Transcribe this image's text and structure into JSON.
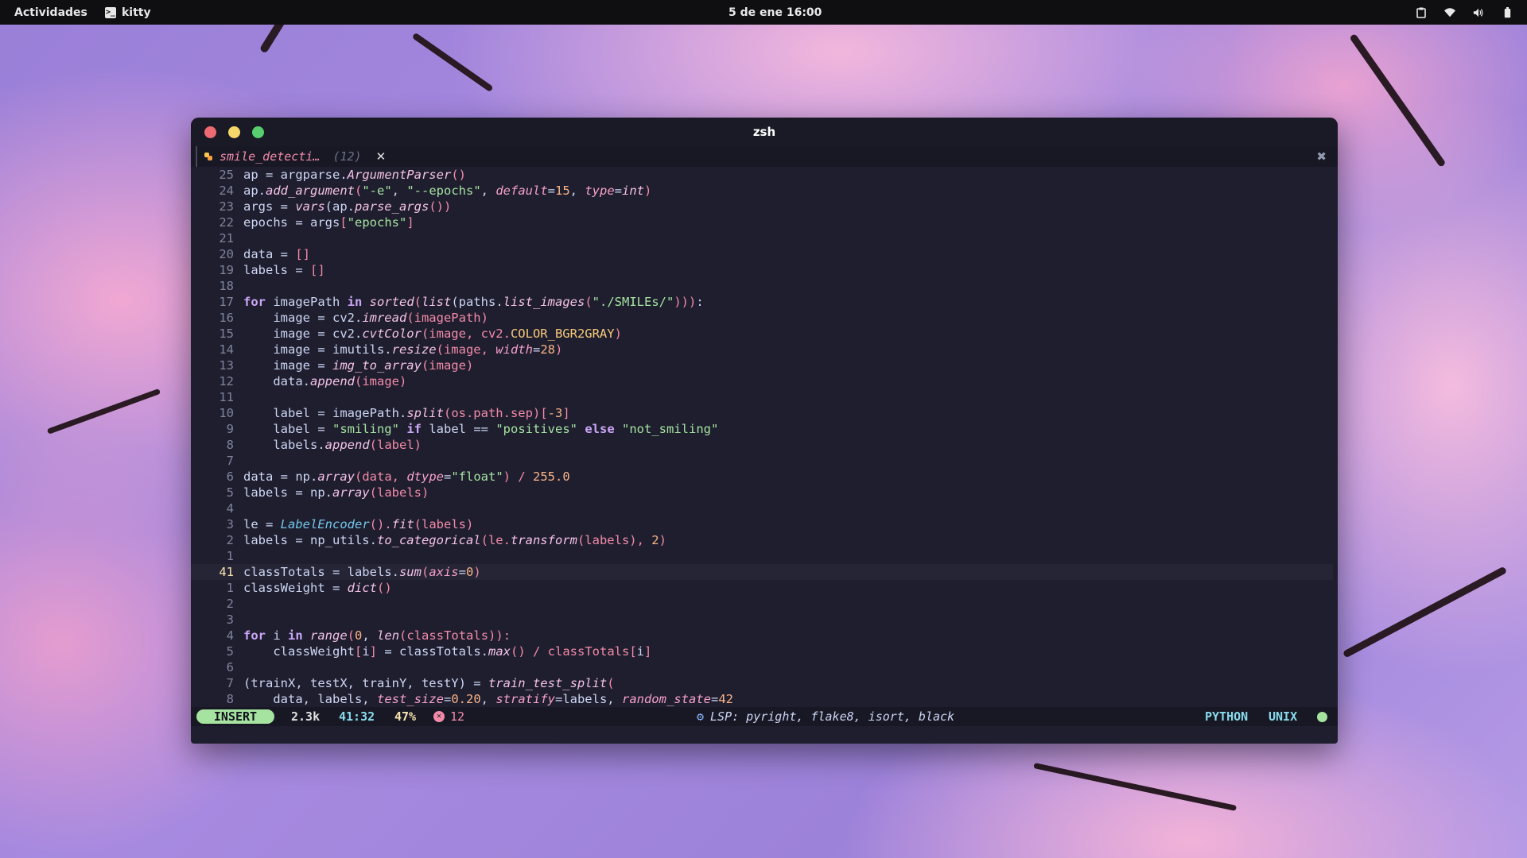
{
  "topbar": {
    "activities": "Actividades",
    "app_name": "kitty",
    "clock": "5 de ene  16:00",
    "icons": [
      "clipboard-icon",
      "wifi-icon",
      "volume-icon",
      "battery-icon"
    ]
  },
  "window": {
    "title": "zsh",
    "buffer_tab": {
      "icon": "python-icon",
      "name": "smile_detecti…",
      "count": "(12)",
      "close": "✕"
    },
    "buffer_close": "✖"
  },
  "editor": {
    "current_line_number": "41",
    "lines": [
      {
        "n": "25",
        "segs": [
          [
            "ap = argparse.",
            "o"
          ],
          [
            "ArgumentParser",
            "f"
          ],
          [
            "()",
            "p"
          ]
        ]
      },
      {
        "n": "24",
        "segs": [
          [
            "ap.",
            "o"
          ],
          [
            "add_argument",
            "f"
          ],
          [
            "(",
            "p"
          ],
          [
            "\"-e\"",
            "s"
          ],
          [
            ", ",
            "o"
          ],
          [
            "\"--epochs\"",
            "s"
          ],
          [
            ", ",
            "o"
          ],
          [
            "default",
            "a"
          ],
          [
            "=",
            "o"
          ],
          [
            "15",
            "n"
          ],
          [
            ", ",
            "o"
          ],
          [
            "type",
            "a"
          ],
          [
            "=",
            "o"
          ],
          [
            "int",
            "f"
          ],
          [
            ")",
            "p"
          ]
        ]
      },
      {
        "n": "23",
        "segs": [
          [
            "args = ",
            "o"
          ],
          [
            "vars",
            "f"
          ],
          [
            "(ap.",
            "o"
          ],
          [
            "parse_args",
            "f"
          ],
          [
            "())",
            "p"
          ]
        ]
      },
      {
        "n": "22",
        "segs": [
          [
            "epochs = args",
            "o"
          ],
          [
            "[",
            "p"
          ],
          [
            "\"epochs\"",
            "s"
          ],
          [
            "]",
            "p"
          ]
        ]
      },
      {
        "n": "21",
        "segs": []
      },
      {
        "n": "20",
        "segs": [
          [
            "data = ",
            "o"
          ],
          [
            "[]",
            "p"
          ]
        ]
      },
      {
        "n": "19",
        "segs": [
          [
            "labels = ",
            "o"
          ],
          [
            "[]",
            "p"
          ]
        ]
      },
      {
        "n": "18",
        "segs": []
      },
      {
        "n": "17",
        "segs": [
          [
            "for",
            "k"
          ],
          [
            " imagePath ",
            "o"
          ],
          [
            "in",
            "k"
          ],
          [
            " ",
            "o"
          ],
          [
            "sorted",
            "f"
          ],
          [
            "(",
            "p"
          ],
          [
            "list",
            "f"
          ],
          [
            "(paths.",
            "o"
          ],
          [
            "list_images",
            "f"
          ],
          [
            "(",
            "p"
          ],
          [
            "\"./SMILEs/\"",
            "s"
          ],
          [
            ")))",
            "p"
          ],
          [
            ":",
            "o"
          ]
        ]
      },
      {
        "n": "16",
        "segs": [
          [
            "    image = cv2.",
            "o"
          ],
          [
            "imread",
            "f"
          ],
          [
            "(imagePath)",
            "p"
          ]
        ]
      },
      {
        "n": "15",
        "segs": [
          [
            "    image = cv2.",
            "o"
          ],
          [
            "cvtColor",
            "f"
          ],
          [
            "(image, cv2.",
            "p"
          ],
          [
            "COLOR_BGR2GRAY",
            "x"
          ],
          [
            ")",
            "p"
          ]
        ]
      },
      {
        "n": "14",
        "segs": [
          [
            "    image = imutils.",
            "o"
          ],
          [
            "resize",
            "f"
          ],
          [
            "(image, ",
            "p"
          ],
          [
            "width",
            "a"
          ],
          [
            "=",
            "o"
          ],
          [
            "28",
            "n"
          ],
          [
            ")",
            "p"
          ]
        ]
      },
      {
        "n": "13",
        "segs": [
          [
            "    image = ",
            "o"
          ],
          [
            "img_to_array",
            "f"
          ],
          [
            "(image)",
            "p"
          ]
        ]
      },
      {
        "n": "12",
        "segs": [
          [
            "    data.",
            "o"
          ],
          [
            "append",
            "f"
          ],
          [
            "(image)",
            "p"
          ]
        ]
      },
      {
        "n": "11",
        "segs": []
      },
      {
        "n": "10",
        "segs": [
          [
            "    label = imagePath.",
            "o"
          ],
          [
            "split",
            "f"
          ],
          [
            "(os.path.sep)",
            "p"
          ],
          [
            "[",
            "p"
          ],
          [
            "-3",
            "n"
          ],
          [
            "]",
            "p"
          ]
        ]
      },
      {
        "n": "9",
        "segs": [
          [
            "    label = ",
            "o"
          ],
          [
            "\"smiling\"",
            "s"
          ],
          [
            " ",
            "o"
          ],
          [
            "if",
            "k"
          ],
          [
            " label == ",
            "o"
          ],
          [
            "\"positives\"",
            "s"
          ],
          [
            " ",
            "o"
          ],
          [
            "else",
            "k"
          ],
          [
            " ",
            "o"
          ],
          [
            "\"not_smiling\"",
            "s"
          ]
        ]
      },
      {
        "n": "8",
        "segs": [
          [
            "    labels.",
            "o"
          ],
          [
            "append",
            "f"
          ],
          [
            "(label)",
            "p"
          ]
        ]
      },
      {
        "n": "7",
        "segs": []
      },
      {
        "n": "6",
        "segs": [
          [
            "data = np.",
            "o"
          ],
          [
            "array",
            "f"
          ],
          [
            "(data, ",
            "p"
          ],
          [
            "dtype",
            "a"
          ],
          [
            "=",
            "o"
          ],
          [
            "\"float\"",
            "s"
          ],
          [
            ") / ",
            "p"
          ],
          [
            "255.0",
            "n"
          ]
        ]
      },
      {
        "n": "5",
        "segs": [
          [
            "labels = np.",
            "o"
          ],
          [
            "array",
            "f"
          ],
          [
            "(labels)",
            "p"
          ]
        ]
      },
      {
        "n": "4",
        "segs": []
      },
      {
        "n": "3",
        "segs": [
          [
            "le = ",
            "o"
          ],
          [
            "LabelEncoder",
            "c"
          ],
          [
            "().",
            "p"
          ],
          [
            "fit",
            "f"
          ],
          [
            "(labels)",
            "p"
          ]
        ]
      },
      {
        "n": "2",
        "segs": [
          [
            "labels = np_utils.",
            "o"
          ],
          [
            "to_categorical",
            "f"
          ],
          [
            "(le.",
            "p"
          ],
          [
            "transform",
            "f"
          ],
          [
            "(labels), ",
            "p"
          ],
          [
            "2",
            "n"
          ],
          [
            ")",
            "p"
          ]
        ]
      },
      {
        "n": "1",
        "segs": []
      },
      {
        "n": "41",
        "segs": [
          [
            "classTotals = labels.",
            "o"
          ],
          [
            "sum",
            "f"
          ],
          [
            "(",
            "p"
          ],
          [
            "axis",
            "a"
          ],
          [
            "=",
            "o"
          ],
          [
            "0",
            "n"
          ],
          [
            ")",
            "p"
          ]
        ]
      },
      {
        "n": "1",
        "segs": [
          [
            "classWeight = ",
            "o"
          ],
          [
            "dict",
            "f"
          ],
          [
            "()",
            "p"
          ]
        ]
      },
      {
        "n": "2",
        "segs": []
      },
      {
        "n": "3",
        "segs": []
      },
      {
        "n": "4",
        "segs": [
          [
            "for",
            "k"
          ],
          [
            " i ",
            "o"
          ],
          [
            "in",
            "k"
          ],
          [
            " ",
            "o"
          ],
          [
            "range",
            "f"
          ],
          [
            "(",
            "p"
          ],
          [
            "0",
            "n"
          ],
          [
            ", ",
            "o"
          ],
          [
            "len",
            "f"
          ],
          [
            "(classTotals)):",
            "p"
          ]
        ]
      },
      {
        "n": "5",
        "segs": [
          [
            "    classWeight",
            "o"
          ],
          [
            "[",
            "p"
          ],
          [
            "i",
            "o"
          ],
          [
            "]",
            "p"
          ],
          [
            " = classTotals.",
            "o"
          ],
          [
            "max",
            "f"
          ],
          [
            "() / classTotals",
            "p"
          ],
          [
            "[",
            "p"
          ],
          [
            "i",
            "o"
          ],
          [
            "]",
            "p"
          ]
        ]
      },
      {
        "n": "6",
        "segs": []
      },
      {
        "n": "7",
        "segs": [
          [
            "(trainX, testX, trainY, testY) = ",
            "o"
          ],
          [
            "train_test_split",
            "f"
          ],
          [
            "(",
            "p"
          ]
        ]
      },
      {
        "n": "8",
        "segs": [
          [
            "    data, labels, ",
            "o"
          ],
          [
            "test_size",
            "a"
          ],
          [
            "=",
            "o"
          ],
          [
            "0.20",
            "n"
          ],
          [
            ", ",
            "o"
          ],
          [
            "stratify",
            "a"
          ],
          [
            "=labels, ",
            "o"
          ],
          [
            "random_state",
            "a"
          ],
          [
            "=",
            "o"
          ],
          [
            "42",
            "n"
          ]
        ]
      }
    ]
  },
  "statusline": {
    "mode": "INSERT",
    "size": "2.3k",
    "position": "41:32",
    "percent": "47%",
    "errors": "12",
    "lsp": "LSP: pyright, flake8, isort, black",
    "filetype": "PYTHON",
    "fileformat": "UNIX",
    "colors": {
      "mode_bg": "#a6e3a1",
      "error": "#f38ba8",
      "status_dot": "#a6e3a1"
    }
  }
}
